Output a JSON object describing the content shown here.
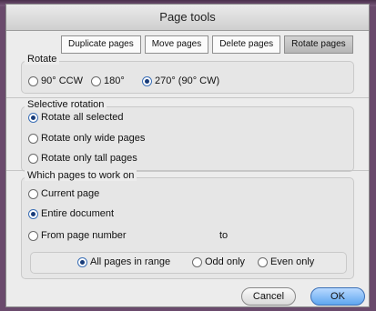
{
  "window": {
    "title": "Page tools"
  },
  "tabs": [
    {
      "label": "Duplicate pages"
    },
    {
      "label": "Move pages"
    },
    {
      "label": "Delete pages"
    },
    {
      "label": "Rotate pages"
    }
  ],
  "rotate": {
    "label": "Rotate",
    "options": [
      "90° CCW",
      "180°",
      "270° (90° CW)"
    ],
    "selected": "270° (90° CW)"
  },
  "selective": {
    "label": "Selective rotation",
    "options": [
      "Rotate all selected",
      "Rotate only wide pages",
      "Rotate only tall pages"
    ],
    "selected": "Rotate all selected"
  },
  "which": {
    "label": "Which pages to work on",
    "options": [
      "Current page",
      "Entire document",
      "From page number"
    ],
    "selected": "Entire document",
    "to_label": "to"
  },
  "range": {
    "options": [
      "All pages in range",
      "Odd only",
      "Even only"
    ],
    "selected": "All pages in range"
  },
  "buttons": {
    "cancel": "Cancel",
    "ok": "OK"
  }
}
